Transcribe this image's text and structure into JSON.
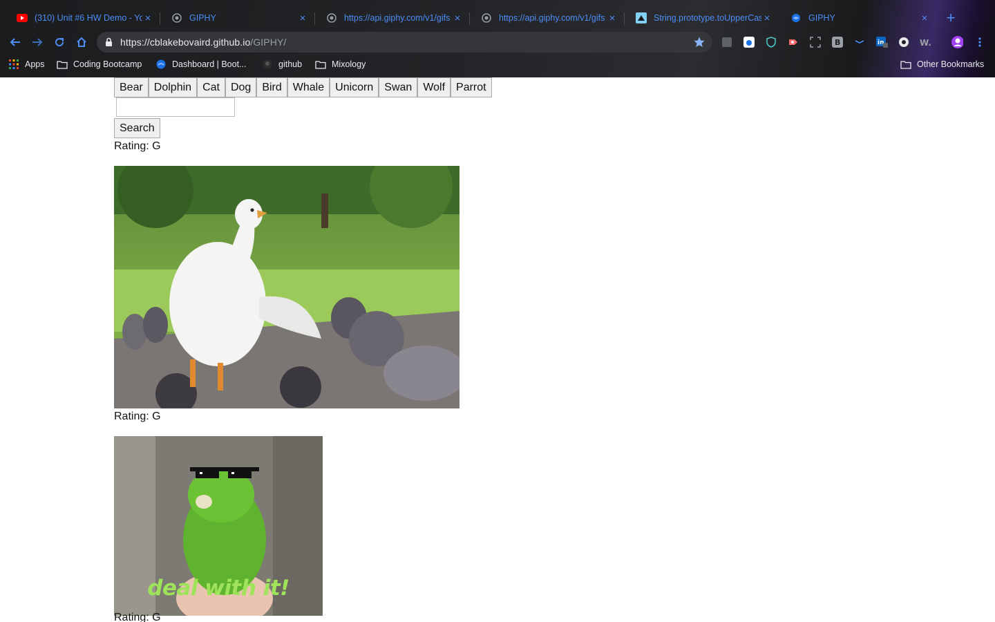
{
  "browser": {
    "tabs": [
      {
        "title": "(310) Unit #6 HW Demo - YouTube",
        "icon": "youtube-icon"
      },
      {
        "title": "GIPHY",
        "icon": "globe-icon"
      },
      {
        "title": "https://api.giphy.com/v1/gifs",
        "icon": "globe-icon"
      },
      {
        "title": "https://api.giphy.com/v1/gifs",
        "icon": "globe-icon"
      },
      {
        "title": "String.prototype.toUpperCase",
        "icon": "mdn-icon"
      },
      {
        "title": "GIPHY",
        "icon": "globe-icon"
      }
    ],
    "close_glyph": "×",
    "new_tab_glyph": "+",
    "url_host": "https://cblakebovaird.github.io",
    "url_path": "/GIPHY/",
    "bookmarks": [
      {
        "label": "Apps",
        "icon": "apps-grid-icon"
      },
      {
        "label": "Coding Bootcamp",
        "icon": "folder-icon"
      },
      {
        "label": "Dashboard | Boot...",
        "icon": "globe-icon"
      },
      {
        "label": "github",
        "icon": "github-icon"
      },
      {
        "label": "Mixology",
        "icon": "folder-icon"
      },
      {
        "label": "Other Bookmarks",
        "icon": "folder-icon"
      }
    ],
    "accent": "#4c8df6"
  },
  "page": {
    "topic_buttons": [
      "Bear",
      "Dolphin",
      "Cat",
      "Dog",
      "Bird",
      "Whale",
      "Unicorn",
      "Swan",
      "Wolf",
      "Parrot"
    ],
    "search_input_value": "",
    "search_label": "Search",
    "gifs": [
      {
        "rating": "Rating: G",
        "subject": "duck-among-pigeons"
      },
      {
        "rating": "Rating: G",
        "subject": "parrot-with-sunglasses",
        "caption": "deal with it!"
      },
      {
        "rating": "Rating: G"
      }
    ]
  }
}
